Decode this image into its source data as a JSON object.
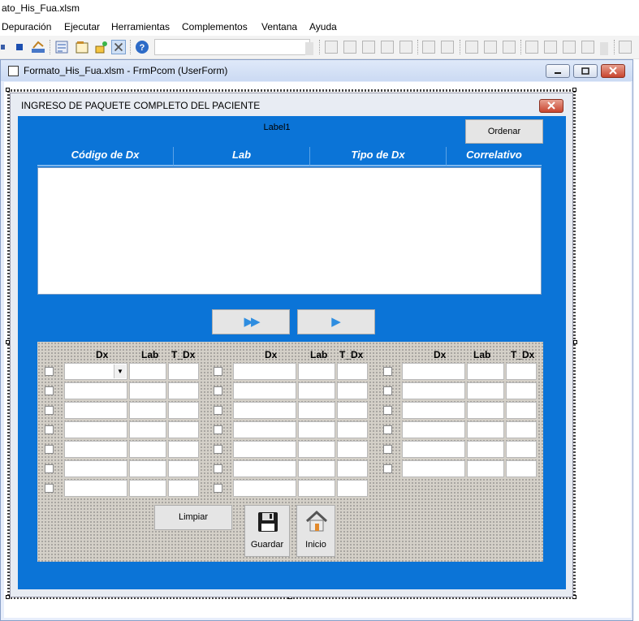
{
  "app": {
    "title": "ato_His_Fua.xlsm"
  },
  "menu": {
    "items": [
      "Depuración",
      "Ejecutar",
      "Herramientas",
      "Complementos",
      "Ventana",
      "Ayuda"
    ]
  },
  "mdi_window": {
    "title": "Formato_His_Fua.xlsm - FrmPcom (UserForm)"
  },
  "form": {
    "caption": "INGRESO DE PAQUETE COMPLETO DEL PACIENTE",
    "label1": "Label1",
    "ordenar_label": "Ordenar",
    "grid_headers": [
      "Código de Dx",
      "Lab",
      "Tipo de Dx",
      "Correlativo"
    ],
    "move_all_glyph": "▶▶",
    "move_one_glyph": "▶",
    "column_headers": {
      "dx": "Dx",
      "lab": "Lab",
      "tdx": "T_Dx"
    },
    "combo_arrow": "▼",
    "limpiar_label": "Limpiar",
    "guardar_label": "Guardar",
    "inicio_label": "Inicio"
  },
  "colors": {
    "form_background": "#0b74d7",
    "panel_background": "#d4d0c8"
  }
}
